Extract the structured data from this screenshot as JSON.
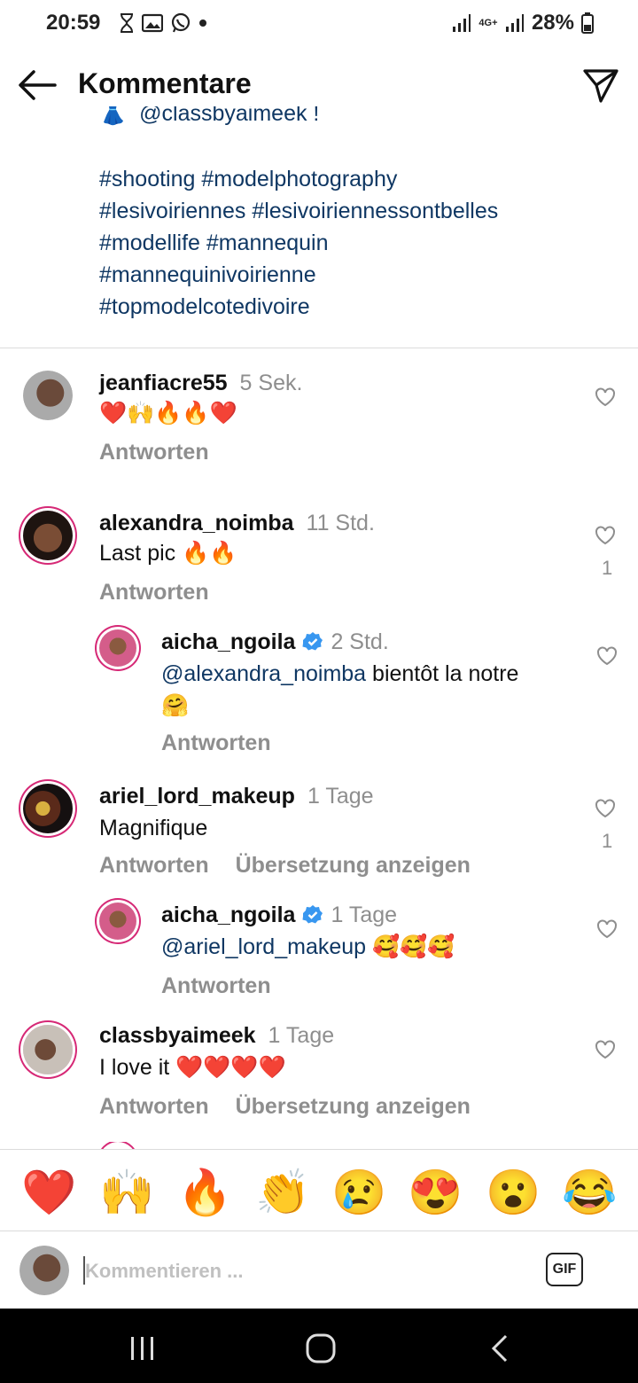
{
  "status_bar": {
    "time": "20:59",
    "battery": "28%",
    "network": "4G+"
  },
  "header": {
    "title": "Kommentare"
  },
  "caption": {
    "cut_text": "@classbyaimeek !",
    "hashtag_lines": [
      "#shooting #modelphotography",
      "#lesivoiriennes #lesivoiriennessontbelles",
      "#modellife #mannequin",
      "#mannequinivoirienne",
      "#topmodelcotedivoire"
    ]
  },
  "comments": [
    {
      "username": "jeanfiacre55",
      "time": "5 Sek.",
      "text": "❤️🙌🔥🔥❤️",
      "reply_label": "Antworten",
      "likes": "",
      "verified": false,
      "avatar_color": "#b9b9b9"
    },
    {
      "username": "alexandra_noimba",
      "time": "11 Std.",
      "text": "Last pic 🔥🔥",
      "reply_label": "Antworten",
      "likes": "1",
      "verified": false,
      "avatar_color": "#5a3a2a"
    },
    {
      "username": "aicha_ngoila",
      "time": "2 Std.",
      "mention": "@alexandra_noimba",
      "text": " bientôt la notre",
      "text2": "🤗",
      "reply_label": "Antworten",
      "likes": "",
      "verified": true,
      "avatar_color": "#b3496a"
    },
    {
      "username": "ariel_lord_makeup",
      "time": "1 Tage",
      "text": "Magnifique",
      "reply_label": "Antworten",
      "translate_label": "Übersetzung anzeigen",
      "likes": "1",
      "verified": false,
      "avatar_color": "#2b1f1a"
    },
    {
      "username": "aicha_ngoila",
      "time": "1 Tage",
      "mention": "@ariel_lord_makeup",
      "text": " 🥰🥰🥰",
      "reply_label": "Antworten",
      "likes": "",
      "verified": true,
      "avatar_color": "#b3496a"
    },
    {
      "username": "classbyaimeek",
      "time": "1 Tage",
      "text": "I love it ❤️❤️❤️❤️",
      "reply_label": "Antworten",
      "translate_label": "Übersetzung anzeigen",
      "likes": "",
      "verified": false,
      "avatar_color": "#8a8a8a"
    }
  ],
  "emoji_bar": [
    "❤️",
    "🙌",
    "🔥",
    "👏",
    "😢",
    "😍",
    "😮",
    "😂"
  ],
  "input": {
    "placeholder": "Kommentieren ...",
    "gif_label": "GIF"
  },
  "colors": {
    "hashtag": "#0f3763",
    "secondary_text": "#8e8e8e",
    "verified": "#3897f0",
    "story_ring": "#d62976"
  }
}
